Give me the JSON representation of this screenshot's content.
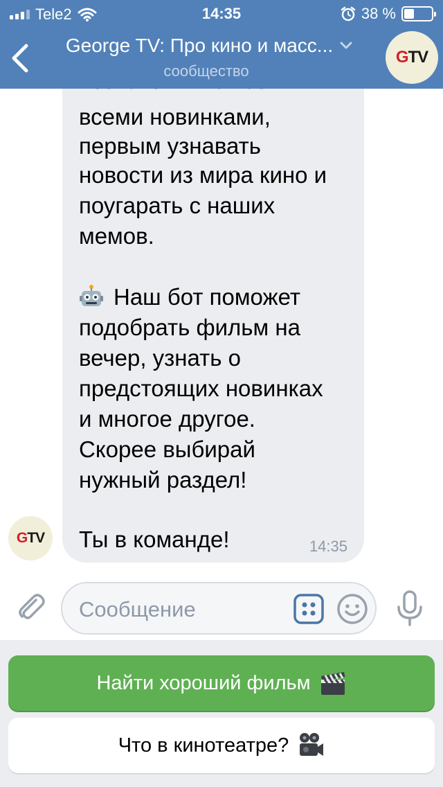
{
  "status_bar": {
    "carrier": "Tele2",
    "time": "14:35",
    "battery_percent": "38 %",
    "battery_level": 0.38
  },
  "header": {
    "title": "George TV: Про кино и масс...",
    "subtitle": "сообщество",
    "back_icon": "chevron-left-icon",
    "dropdown_icon": "chevron-down-icon",
    "avatar_logo": "GTV",
    "avatar_logo_g": "G",
    "avatar_logo_tv": "TV"
  },
  "message": {
    "lines": [
      "познакомиться со",
      "всеми новинками,",
      "первым узнавать",
      "новости из мира кино и",
      "поугарать с наших",
      "мемов.",
      "Наш бот поможет",
      "подобрать фильм на",
      "вечер, узнать о",
      "предстоящих новинках",
      "и многое другое.",
      "Скорее выбирай",
      "нужный раздел!",
      "Ты в команде!"
    ],
    "time": "14:35",
    "emoji_icon": "robot-icon",
    "sender_logo": "GTV"
  },
  "composer": {
    "placeholder": "Сообщение",
    "icons": [
      "paperclip-icon",
      "apps-icon",
      "smile-icon",
      "microphone-icon"
    ]
  },
  "keyboard": {
    "buttons": [
      {
        "label": "Найти хороший фильм",
        "icon": "clapperboard-icon",
        "color": "#5fb053"
      },
      {
        "label": "Что в кинотеатре?",
        "icon": "movie-camera-icon",
        "color": "#ffffff"
      }
    ]
  },
  "colors": {
    "header": "#5181b8",
    "bubble": "#ebedf0",
    "primary_button": "#5fb053",
    "accent_icon": "#4a76a8"
  }
}
